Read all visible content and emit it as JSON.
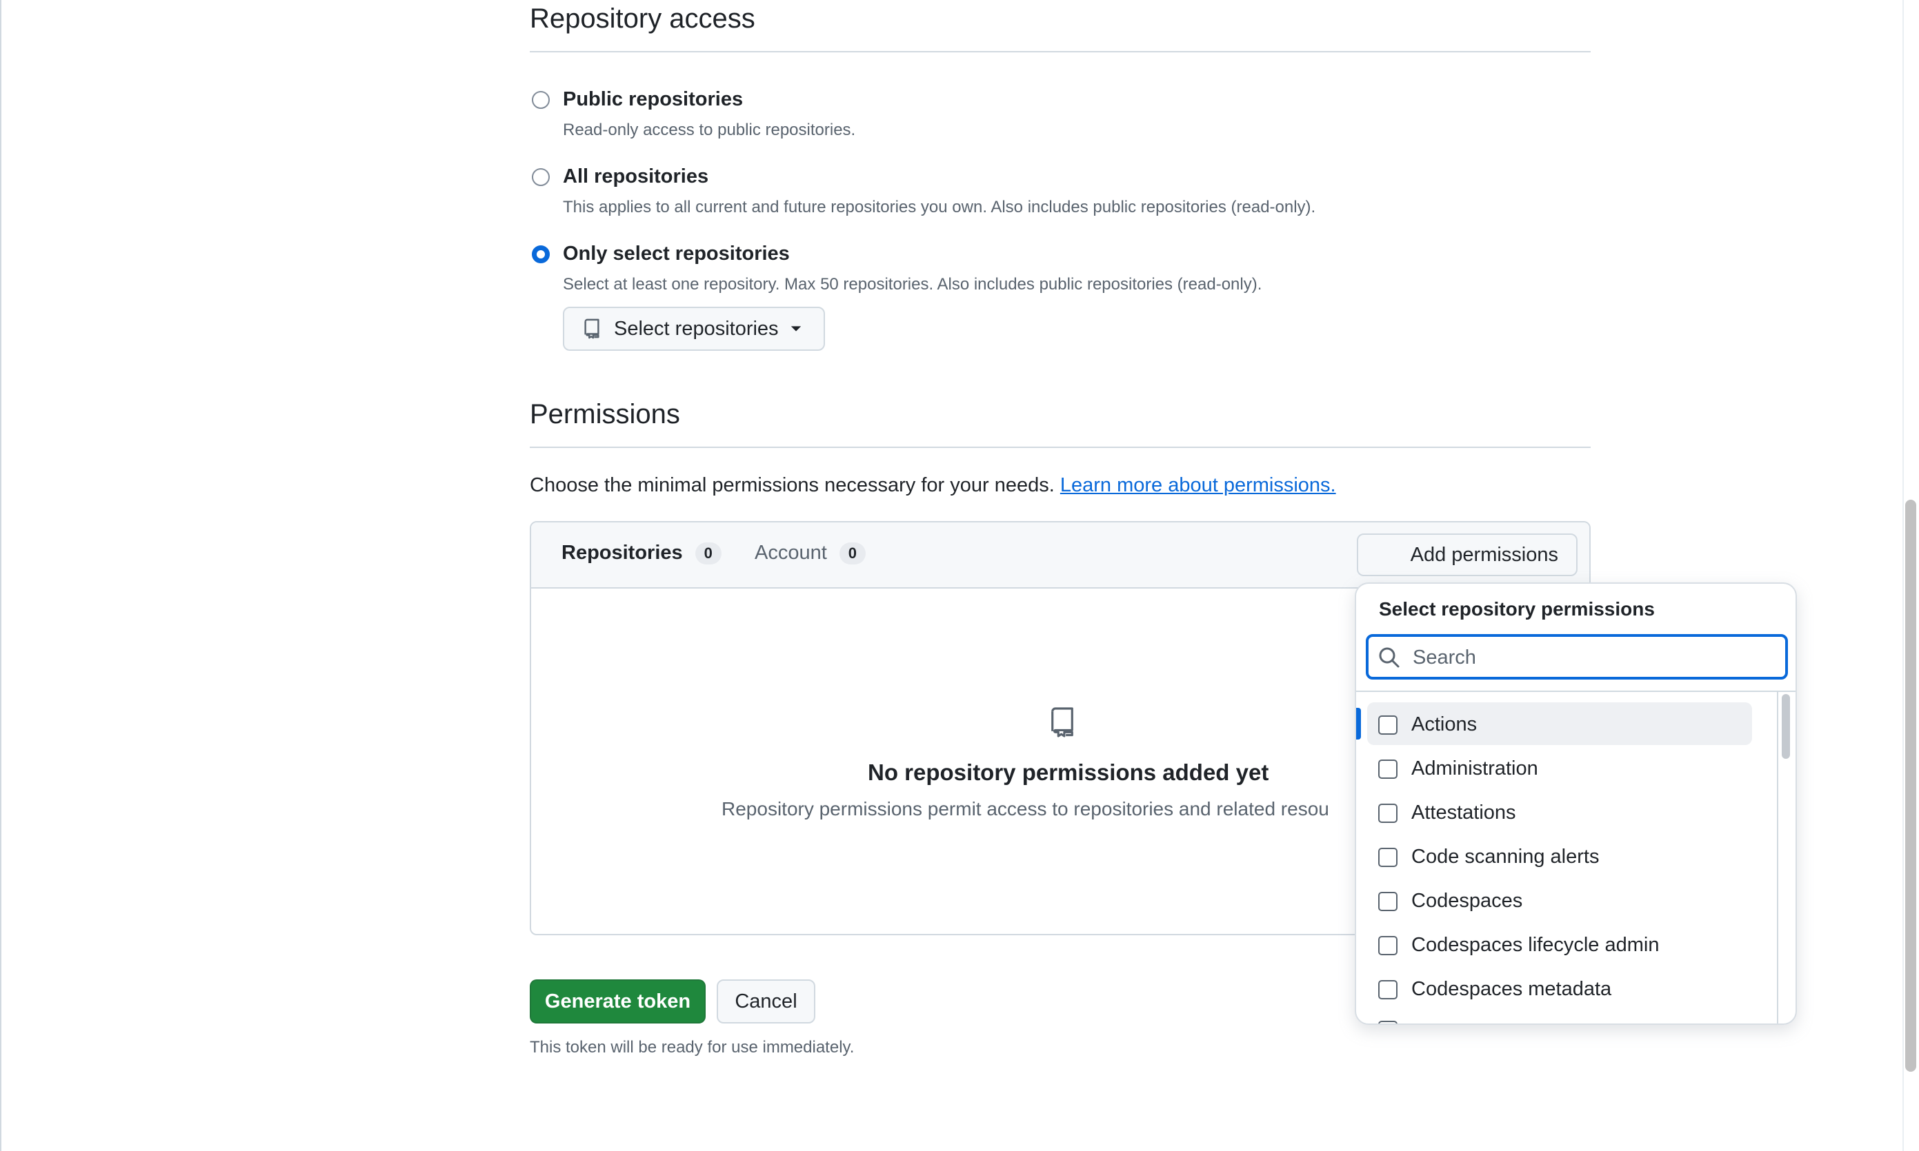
{
  "repository_access": {
    "title": "Repository access",
    "options": [
      {
        "label": "Public repositories",
        "description": "Read-only access to public repositories.",
        "checked": false
      },
      {
        "label": "All repositories",
        "description": "This applies to all current and future repositories you own. Also includes public repositories (read-only).",
        "checked": false
      },
      {
        "label": "Only select repositories",
        "description": "Select at least one repository. Max 50 repositories. Also includes public repositories (read-only).",
        "checked": true
      }
    ],
    "select_button_label": "Select repositories"
  },
  "permissions": {
    "title": "Permissions",
    "intro": "Choose the minimal permissions necessary for your needs.",
    "intro_link": "Learn more about permissions.",
    "tabs": [
      {
        "label": "Repositories",
        "count": "0"
      },
      {
        "label": "Account",
        "count": "0"
      }
    ],
    "add_button_label": "Add permissions",
    "empty_state": {
      "title": "No repository permissions added yet",
      "description": "Repository permissions permit access to repositories and related resou"
    }
  },
  "dropdown": {
    "title": "Select repository permissions",
    "search_placeholder": "Search",
    "items": [
      "Actions",
      "Administration",
      "Attestations",
      "Code scanning alerts",
      "Codespaces",
      "Codespaces lifecycle admin",
      "Codespaces metadata"
    ]
  },
  "footer": {
    "generate_label": "Generate token",
    "cancel_label": "Cancel",
    "note": "This token will be ready for use immediately."
  },
  "colors": {
    "accent": "#0969da",
    "primary_button": "#1f883d",
    "border": "#d1d9e0",
    "muted_text": "#59636e"
  }
}
